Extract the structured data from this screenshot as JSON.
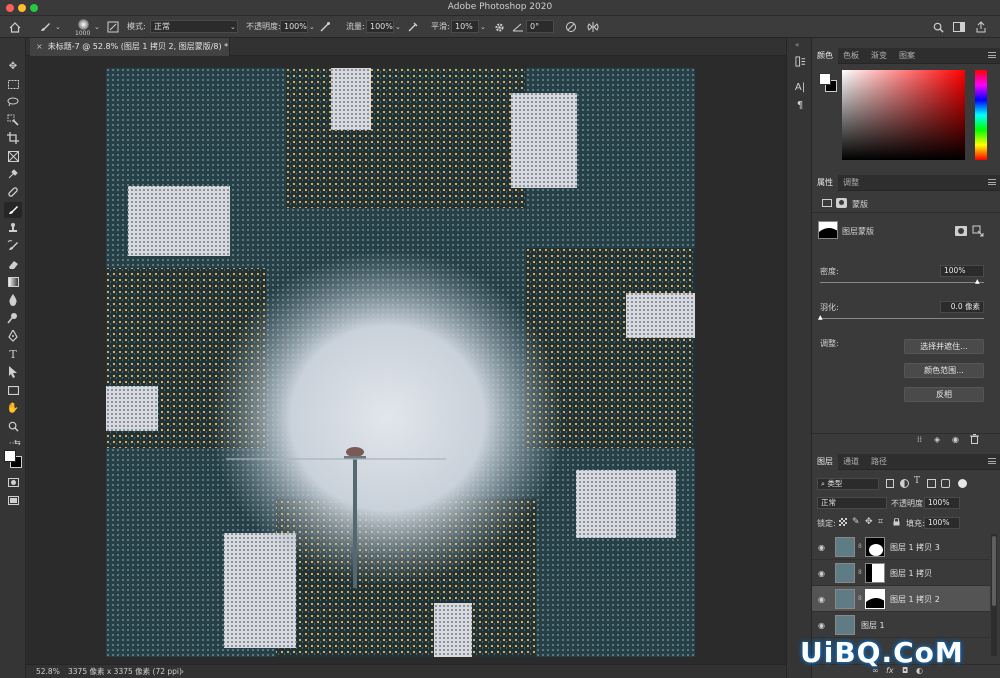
{
  "app": {
    "title": "Adobe Photoshop 2020"
  },
  "options": {
    "brush_size": "1000",
    "mode_label": "模式:",
    "mode_value": "正常",
    "opacity_label": "不透明度:",
    "opacity_value": "100%",
    "flow_label": "流量:",
    "flow_value": "100%",
    "smoothing_label": "平滑:",
    "smoothing_value": "10%",
    "angle_value": "0°"
  },
  "document": {
    "tab_label": "未标题-7 @ 52.8% (图层 1 拷贝 2, 图层蒙版/8) *",
    "zoom": "52.8%",
    "size_info": "3375 像素 x 3375 像素 (72 ppi)"
  },
  "color_panel": {
    "tabs": [
      "颜色",
      "色板",
      "渐变",
      "图案"
    ],
    "foreground": "#ffffff",
    "background": "#000000"
  },
  "properties_panel": {
    "tabs": [
      "属性",
      "调整"
    ],
    "type_label": "蒙版",
    "mask_label": "图层蒙版",
    "density_label": "密度:",
    "density_value": "100%",
    "feather_label": "羽化:",
    "feather_value": "0.0 像素",
    "adjust_label": "调整:",
    "buttons": [
      "选择并遮住...",
      "颜色范围...",
      "反相"
    ]
  },
  "layers_panel": {
    "tabs": [
      "图层",
      "通道",
      "路径"
    ],
    "filter_label": "类型",
    "blend_mode": "正常",
    "opacity_label": "不透明度:",
    "opacity_value": "100%",
    "lock_label": "锁定:",
    "fill_label": "填充:",
    "fill_value": "100%",
    "layers": [
      {
        "name": "图层 1 拷贝 3",
        "selected": false,
        "has_mask": true
      },
      {
        "name": "图层 1 拷贝",
        "selected": false,
        "has_mask": true
      },
      {
        "name": "图层 1 拷贝 2",
        "selected": true,
        "has_mask": true
      },
      {
        "name": "图层 1",
        "selected": false,
        "has_mask": false
      }
    ]
  },
  "watermark": "UiBQ.CoM"
}
